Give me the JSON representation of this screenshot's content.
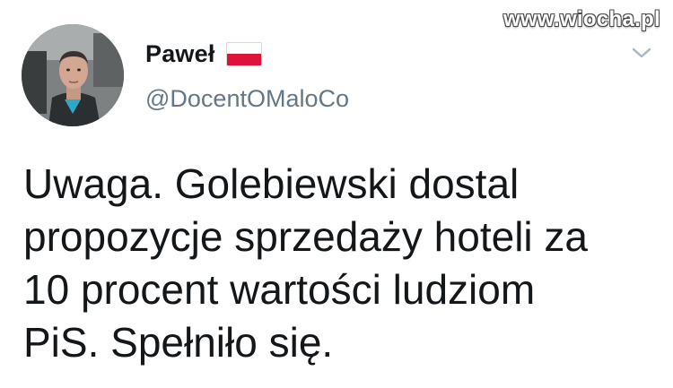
{
  "watermark": "www.wiocha.pl",
  "author": {
    "display_name": "Paweł",
    "handle": "@DocentOMaloCo",
    "flag_icon": "poland-flag-icon",
    "avatar_icon": "profile-avatar"
  },
  "menu": {
    "icon": "chevron-down-icon"
  },
  "tweet": {
    "lines": [
      "Uwaga. Golebiewski dostal",
      "propozycje sprzedaży hoteli za",
      "10 procent wartości ludziom",
      "PiS. Spełniło się."
    ]
  },
  "colors": {
    "text": "#14171a",
    "secondary": "#657786",
    "flag_red": "#dc143c"
  }
}
